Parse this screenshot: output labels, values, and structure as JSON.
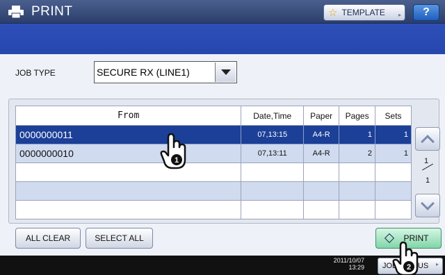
{
  "header": {
    "title": "PRINT",
    "template_label": "TEMPLATE",
    "help_label": "?"
  },
  "job_type": {
    "label": "JOB TYPE",
    "selected": "SECURE RX (LINE1)"
  },
  "table": {
    "columns": [
      "From",
      "Date,Time",
      "Paper",
      "Pages",
      "Sets"
    ],
    "rows": [
      {
        "from": "0000000011",
        "date_time": "07,13:15",
        "paper": "A4-R",
        "pages": "1",
        "sets": "1",
        "selected": true
      },
      {
        "from": "0000000010",
        "date_time": "07,13:11",
        "paper": "A4-R",
        "pages": "2",
        "sets": "1",
        "selected": false
      }
    ]
  },
  "pagination": {
    "current": "1",
    "total": "1"
  },
  "buttons": {
    "all_clear": "ALL CLEAR",
    "select_all": "SELECT ALL",
    "print": "PRINT"
  },
  "footer": {
    "date": "2011/10/07",
    "time": "13:29",
    "job_status": "JOB STATUS"
  },
  "callouts": {
    "step1": "1",
    "step2": "2"
  },
  "colors": {
    "title_bar": "#2c3f6b",
    "blue_bar": "#2547ad",
    "selected_row": "#1c3f97",
    "alt_row": "#d0dbef",
    "print_button": "#7fd6a8"
  },
  "icons": [
    "printer-icon",
    "star-icon",
    "help-icon",
    "chevron-up-icon",
    "chevron-down-icon",
    "start-icon",
    "hand-pointer-icon"
  ]
}
